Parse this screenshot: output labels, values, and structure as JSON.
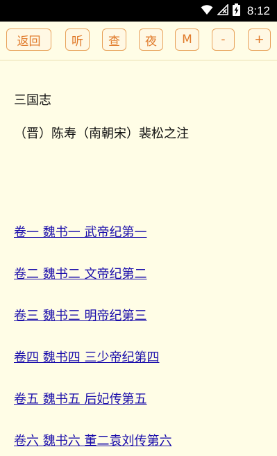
{
  "status_bar": {
    "time": "8:12",
    "icons": [
      "wifi-icon",
      "cellular-no-signal-icon",
      "battery-charging-icon"
    ]
  },
  "toolbar": {
    "back_label": "返回",
    "listen_label": "听",
    "search_label": "查",
    "night_label": "夜",
    "menu_label": "M",
    "decrease_label": "-",
    "increase_label": "+"
  },
  "book": {
    "title": "三国志",
    "author": "（晋）陈寿（南朝宋）裴松之注"
  },
  "chapters": [
    "卷一 魏书一 武帝纪第一",
    "卷二 魏书二 文帝纪第二",
    "卷三 魏书三 明帝纪第三",
    "卷四 魏书四 三少帝纪第四",
    "卷五 魏书五 后妃传第五",
    "卷六 魏书六 董二袁刘传第六"
  ],
  "colors": {
    "background": "#FFFDE6",
    "button_border": "#E8A25A",
    "button_text": "#E07A2A",
    "link": "#1A0DAB"
  }
}
